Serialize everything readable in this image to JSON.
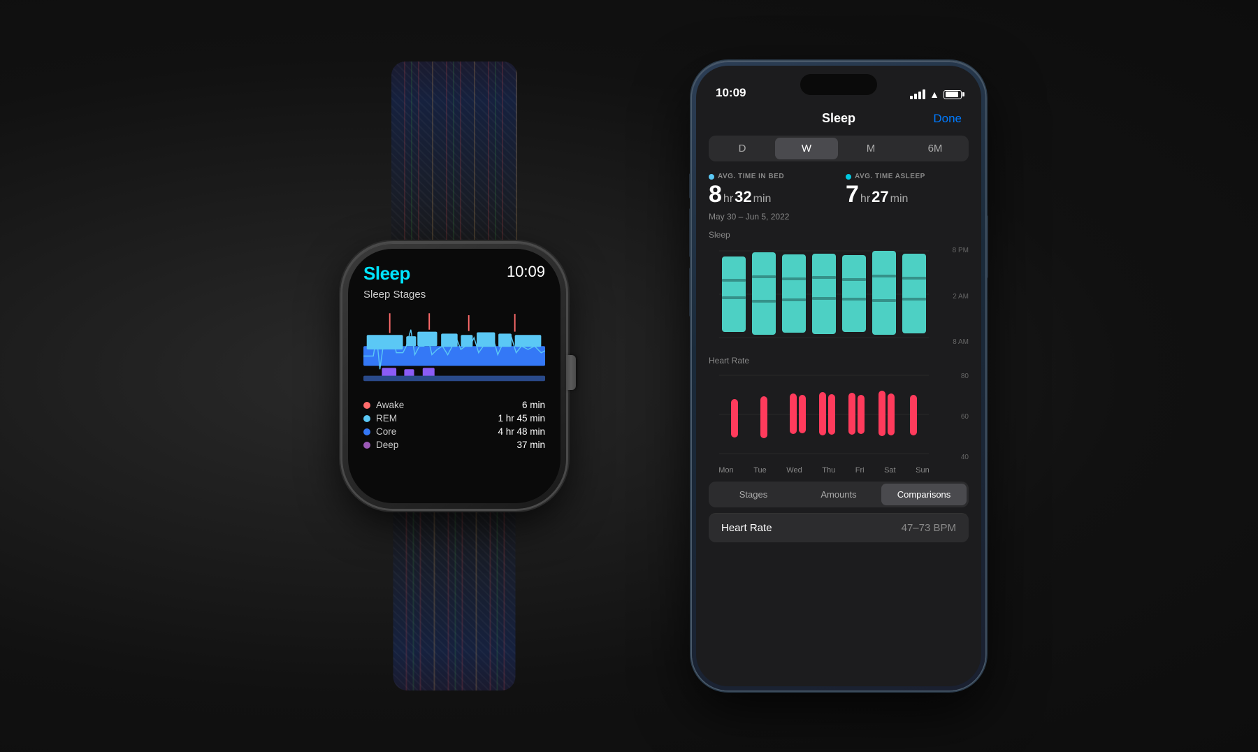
{
  "background": "#1a1a1a",
  "watch": {
    "app_title": "Sleep",
    "time": "10:09",
    "subtitle": "Sleep Stages",
    "legend": [
      {
        "label": "Awake",
        "color": "#FF6B6B",
        "value": "6 min"
      },
      {
        "label": "REM",
        "color": "#5BC8F5",
        "value": "1 hr 45 min"
      },
      {
        "label": "Core",
        "color": "#3478F6",
        "value": "4 hr 48 min"
      },
      {
        "label": "Deep",
        "color": "#9B59B6",
        "value": "37 min"
      }
    ]
  },
  "phone": {
    "status_time": "10:09",
    "app_title": "Sleep",
    "done_button": "Done",
    "period_buttons": [
      "D",
      "W",
      "M",
      "6M"
    ],
    "active_period": "W",
    "stats": {
      "time_in_bed": {
        "label": "AVG. TIME IN BED",
        "dot_color": "#5BC8F5",
        "hours": "8",
        "hr_unit": "hr",
        "minutes": "32",
        "min_unit": "min"
      },
      "time_asleep": {
        "label": "AVG. TIME ASLEEP",
        "dot_color": "#00C8E0",
        "hours": "7",
        "hr_unit": "hr",
        "minutes": "27",
        "min_unit": "min"
      }
    },
    "date_range": "May 30 – Jun 5, 2022",
    "sleep_chart_label": "Sleep",
    "sleep_y_labels": [
      "8 PM",
      "2 AM",
      "8 AM"
    ],
    "heart_rate_label": "Heart Rate",
    "heart_rate_y_labels": [
      "80",
      "60",
      "40"
    ],
    "day_labels": [
      "Mon",
      "Tue",
      "Wed",
      "Thu",
      "Fri",
      "Sat",
      "Sun"
    ],
    "bottom_tabs": [
      "Stages",
      "Amounts",
      "Comparisons"
    ],
    "active_tab": "Comparisons",
    "heart_rate_range": {
      "label": "Heart Rate",
      "value": "47–73 BPM"
    }
  }
}
